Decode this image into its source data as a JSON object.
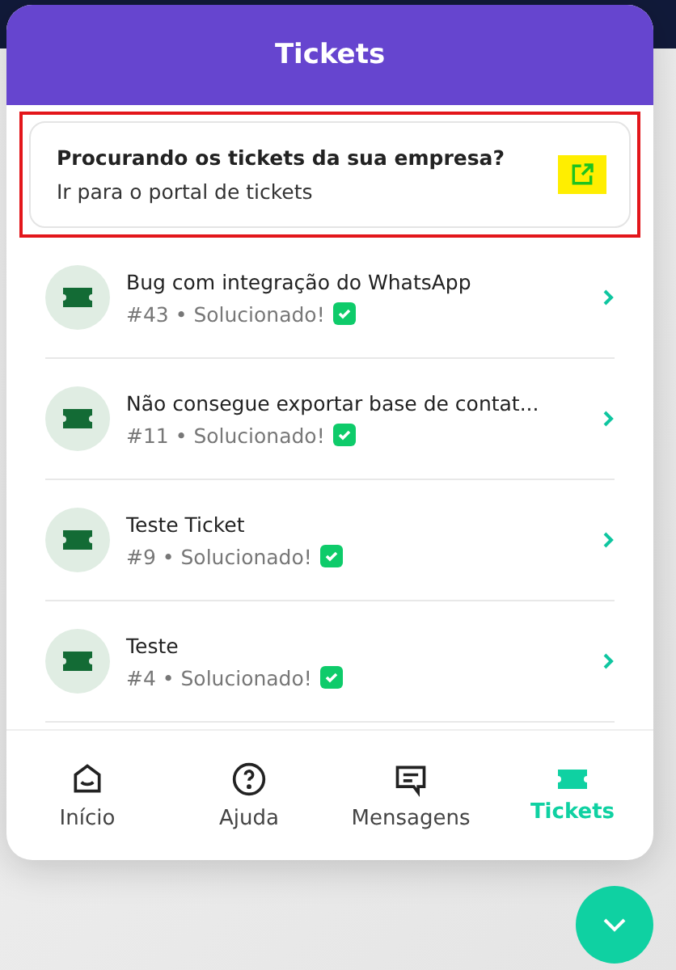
{
  "header": {
    "title": "Tickets"
  },
  "portal_card": {
    "title": "Procurando os tickets da sua empresa?",
    "subtitle": "Ir para o portal de tickets",
    "highlighted": true
  },
  "tickets": [
    {
      "title": "Bug com integração do WhatsApp",
      "meta": "#43 • Solucionado!",
      "resolved": true
    },
    {
      "title": "Não consegue exportar base de contat...",
      "meta": "#11 • Solucionado!",
      "resolved": true
    },
    {
      "title": "Teste Ticket",
      "meta": "#9 • Solucionado!",
      "resolved": true
    },
    {
      "title": "Teste",
      "meta": "#4 • Solucionado!",
      "resolved": true
    }
  ],
  "tabs": [
    {
      "label": "Início",
      "kind": "home",
      "selected": false
    },
    {
      "label": "Ajuda",
      "kind": "help",
      "selected": false
    },
    {
      "label": "Mensagens",
      "kind": "messages",
      "selected": false
    },
    {
      "label": "Tickets",
      "kind": "tickets",
      "selected": true
    }
  ]
}
